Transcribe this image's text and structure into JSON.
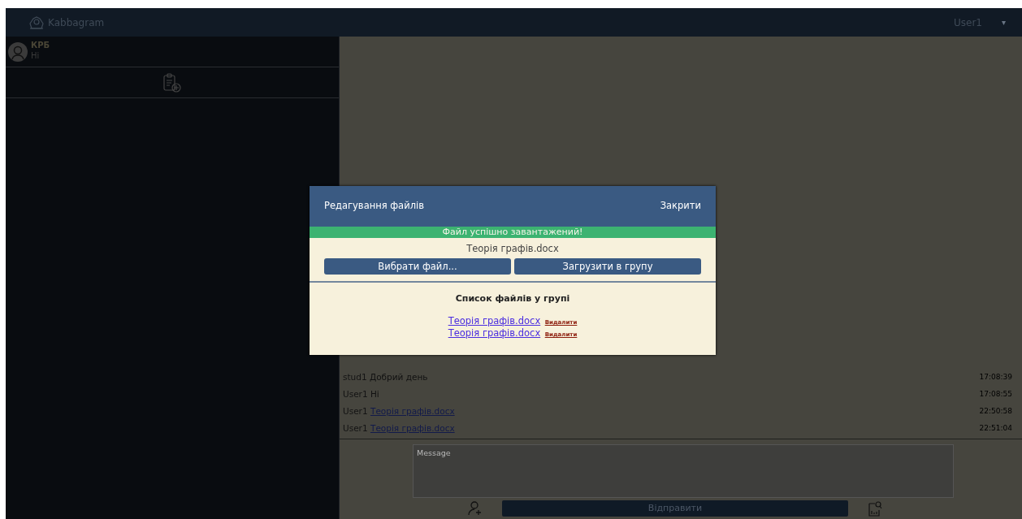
{
  "navbar": {
    "brand": "Kabbagram",
    "user": "User1",
    "caret": "▾"
  },
  "sidebar": {
    "chats": [
      {
        "name": "КРБ",
        "last_message": "Hi"
      }
    ]
  },
  "messages": [
    {
      "author": "User1",
      "text": "Hi",
      "time": "17:08:55",
      "kind": "text"
    },
    {
      "author": "User1",
      "text": "Теорія графів.docx",
      "time": "22:50:58",
      "kind": "file"
    },
    {
      "author": "User1",
      "text": "Теорія графів.docx",
      "time": "22:51:04",
      "kind": "file"
    }
  ],
  "first_message": {
    "author": "stud1",
    "text": "Добрий день",
    "time": "17:08:39",
    "kind": "text"
  },
  "composer": {
    "placeholder": "Message",
    "send": "Відправити"
  },
  "modal": {
    "title": "Редагування файлів",
    "close": "Закрити",
    "alert": "Файл успішно завантажений!",
    "chosen_file": "Теорія графів.docx",
    "choose_button": "Вибрати файл...",
    "upload_button": "Загрузити в групу",
    "list_title": "Список файлів у групі",
    "files": [
      {
        "name": "Теорія графів.docx",
        "delete": "Видалити"
      },
      {
        "name": "Теорія графів.docx",
        "delete": "Видалити"
      }
    ]
  }
}
